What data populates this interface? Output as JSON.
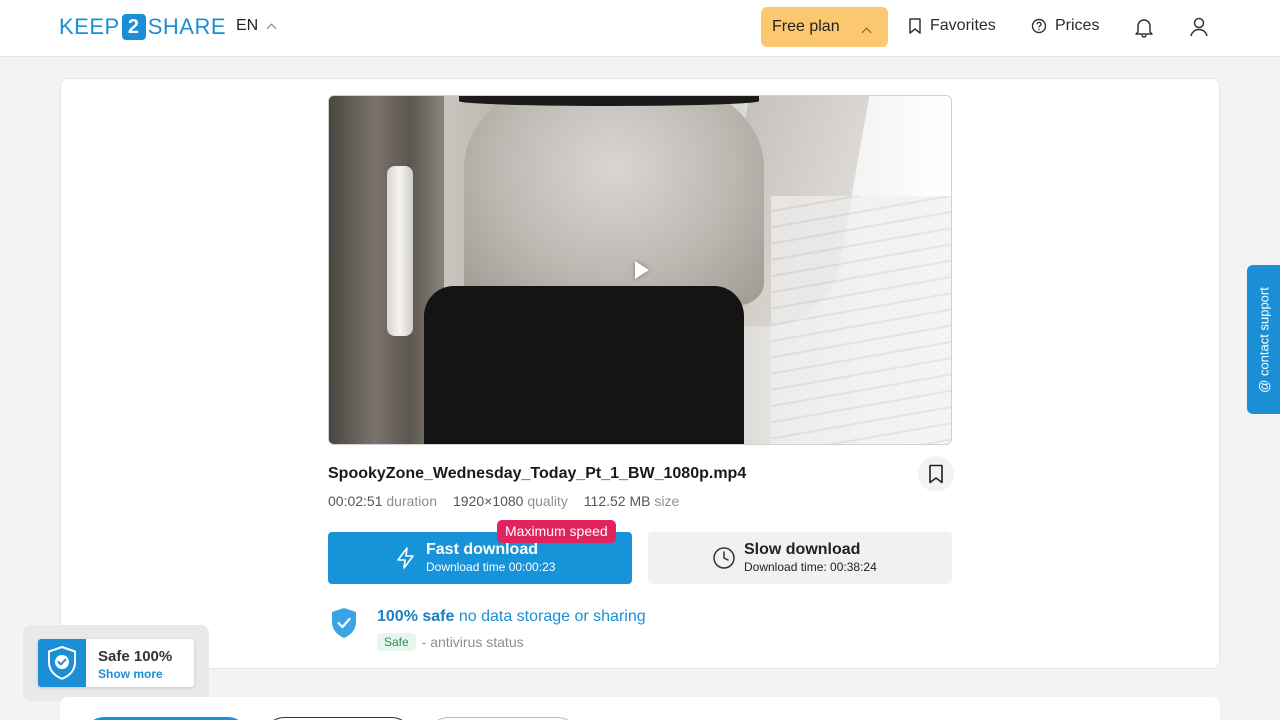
{
  "header": {
    "logo_left": "KEEP",
    "logo_mid": "2",
    "logo_right": "SHARE",
    "language": "EN",
    "plan_label": "Free plan",
    "favorites_label": "Favorites",
    "prices_label": "Prices"
  },
  "file": {
    "name": "SpookyZone_Wednesday_Today_Pt_1_BW_1080p.mp4",
    "duration_value": "00:02:51",
    "duration_label": "duration",
    "quality_value": "1920×1080",
    "quality_label": "quality",
    "size_value": "112.52 MB",
    "size_label": "size"
  },
  "download": {
    "badge": "Maximum speed",
    "fast_title": "Fast download",
    "fast_sub": "Download time 00:00:23",
    "slow_title": "Slow download",
    "slow_sub": "Download time: 00:38:24"
  },
  "safety": {
    "strong": "100% safe",
    "rest": "no data storage or sharing",
    "badge": "Safe",
    "status": "- antivirus status"
  },
  "widget": {
    "title": "Safe 100%",
    "link": "Show more"
  },
  "support": {
    "label": "@ contact support"
  },
  "colors": {
    "brand": "#1b8fd6",
    "plan": "#fbc76f",
    "badge": "#e0245e"
  }
}
